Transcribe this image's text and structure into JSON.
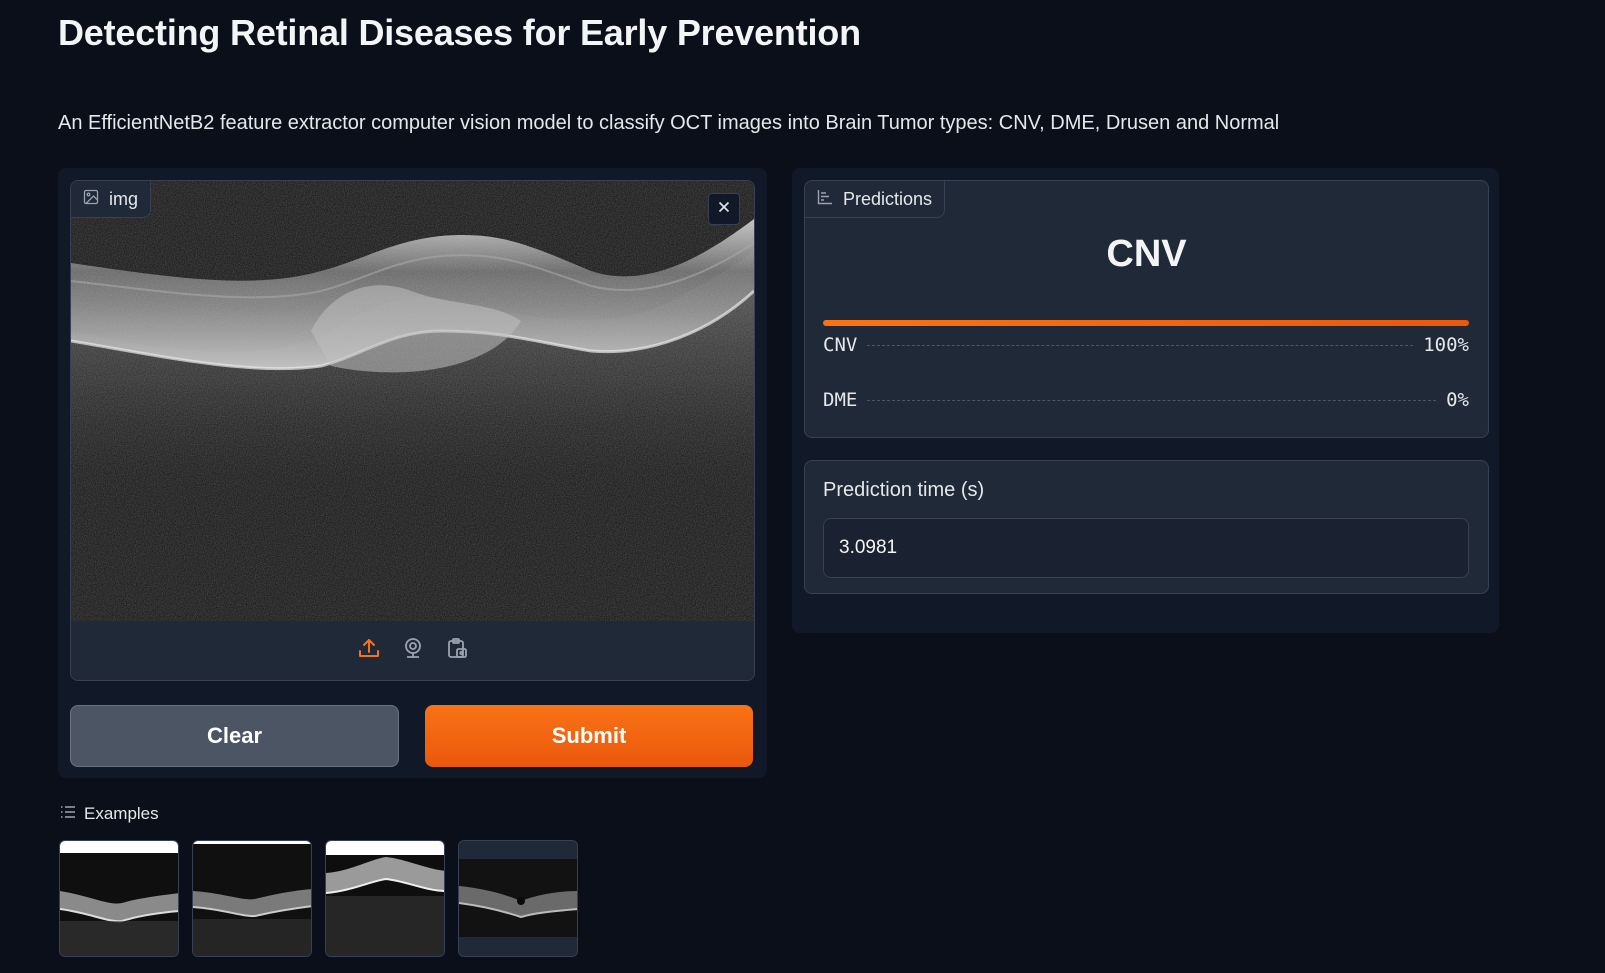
{
  "page": {
    "title": "Detecting Retinal Diseases for Early Prevention",
    "description": "An EfficientNetB2 feature extractor computer vision model to classify OCT images into Brain Tumor types: CNV, DME, Drusen and Normal"
  },
  "input": {
    "label": "img",
    "label_icon": "image-icon",
    "close_icon": "close-icon",
    "sources": [
      "upload-icon",
      "webcam-icon",
      "clipboard-icon"
    ],
    "accent": "#f97316"
  },
  "buttons": {
    "clear_label": "Clear",
    "submit_label": "Submit"
  },
  "predictions": {
    "label": "Predictions",
    "label_icon": "bar-chart-icon",
    "top_class": "CNV",
    "confidences": [
      {
        "label": "CNV",
        "value_text": "100%",
        "fraction": 1.0
      },
      {
        "label": "DME",
        "value_text": "0%",
        "fraction": 0.0
      }
    ]
  },
  "prediction_time": {
    "label": "Prediction time (s)",
    "value": "3.0981"
  },
  "examples": {
    "label": "Examples",
    "icon": "list-icon",
    "count": 4
  }
}
